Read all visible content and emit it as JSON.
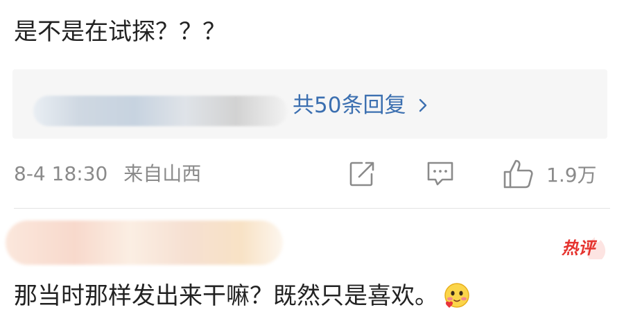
{
  "comment1": {
    "text": "是不是在试探？？？",
    "replies_link": "共50条回复",
    "timestamp": "8-4 18:30",
    "location": "来自山西",
    "like_count": "1.9万"
  },
  "comment2": {
    "badge": "热评",
    "text": "那当时那样发出来干嘛？既然只是喜欢。",
    "emoji": "blush-emoji"
  },
  "colors": {
    "link": "#3b6fb0",
    "meta": "#8a8a8a",
    "hot": "#e5332e"
  }
}
